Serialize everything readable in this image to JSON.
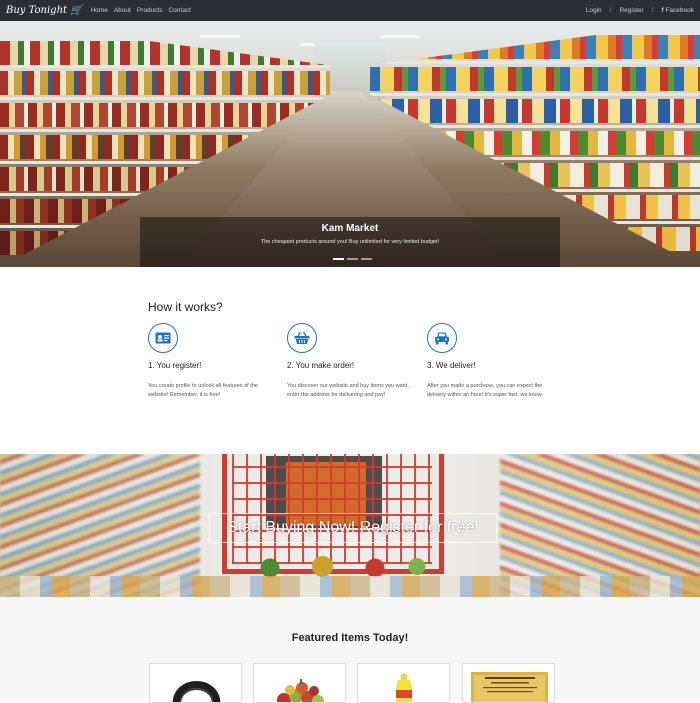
{
  "navbar": {
    "brand": "Buy Tonight",
    "links": [
      "Home",
      "About",
      "Products",
      "Contact"
    ],
    "login": "Login",
    "separator": "/",
    "register": "Register",
    "facebook": "Facebook"
  },
  "hero": {
    "title": "Kam Market",
    "subtitle": "The cheapest products around you! Buy unlimited for very limited budget!",
    "indicator_count": 3,
    "active_indicator": 1
  },
  "how_it_works": {
    "title": "How it works?",
    "steps": [
      {
        "icon": "id-card-icon",
        "title": "1. You register!",
        "text": "You create profile to unlock all features of the website! Remember, it is free!"
      },
      {
        "icon": "basket-icon",
        "title": "2. You make order!",
        "text": "You discover our website and buy items you want, enter the address for delivering and pay!"
      },
      {
        "icon": "car-icon",
        "title": "3. We deliver!",
        "text": "After you made a purchase, you can expect the delivery within an hour! It's super fast, we know"
      }
    ]
  },
  "cta": {
    "text": "Start Buying Now! Register for free!"
  },
  "featured": {
    "title": "Featured Items Today!",
    "items": [
      {
        "name": "headphones"
      },
      {
        "name": "apples"
      },
      {
        "name": "bottle"
      },
      {
        "name": "certificate"
      }
    ]
  },
  "colors": {
    "navbar_bg": "#2b2f33",
    "accent_blue": "#1c73c9",
    "cart_red": "#d63a2a"
  }
}
